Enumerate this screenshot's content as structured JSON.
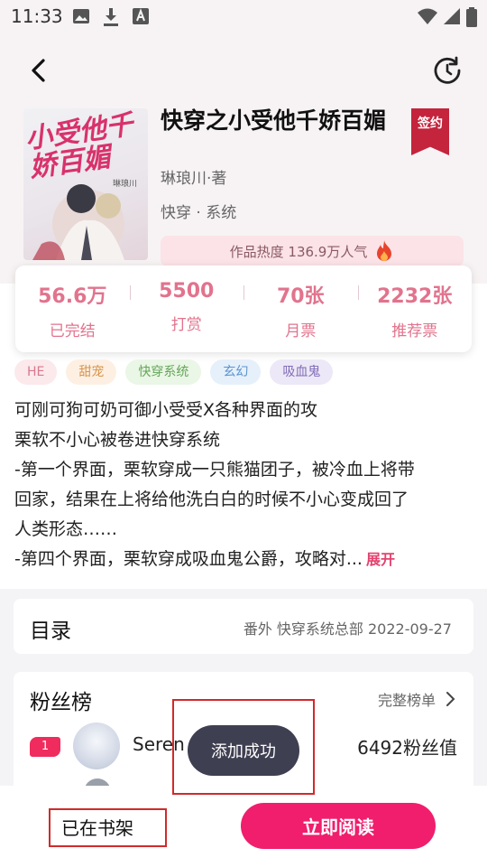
{
  "status_bar": {
    "time": "11:33",
    "left_icons": [
      "image-icon",
      "download-icon",
      "text-a-icon"
    ],
    "right_icons": [
      "wifi-icon",
      "signal-icon",
      "battery-icon"
    ]
  },
  "header": {
    "back_icon": "chevron-left-icon",
    "refresh_icon": "refresh-icon"
  },
  "book": {
    "cover_title": "小受他千娇百媚",
    "cover_author": "琳琅川",
    "title": "快穿之小受他千娇百媚",
    "author": "琳琅川·著",
    "genre": "快穿 · 系统",
    "signed_badge": "签约",
    "heat_text": "作品热度 136.9万人气",
    "heat_icon": "flame-icon"
  },
  "stats": [
    {
      "value": "56.6万",
      "label": "已完结"
    },
    {
      "value": "5500",
      "label": "打赏"
    },
    {
      "value": "70张",
      "label": "月票"
    },
    {
      "value": "2232张",
      "label": "推荐票"
    }
  ],
  "tags": [
    {
      "label": "HE",
      "bg": "#fbe9ec",
      "fg": "#d9788c"
    },
    {
      "label": "甜宠",
      "bg": "#fdf0e3",
      "fg": "#d8944d"
    },
    {
      "label": "快穿系统",
      "bg": "#eaf6e6",
      "fg": "#64a558"
    },
    {
      "label": "玄幻",
      "bg": "#e5f0fb",
      "fg": "#5b93cf"
    },
    {
      "label": "吸血鬼",
      "bg": "#ece8f7",
      "fg": "#7f6bb6"
    }
  ],
  "intro": {
    "lines": [
      "可刚可狗可奶可御小受受X各种界面的攻",
      "栗软不小心被卷进快穿系统",
      "-第一个界面，栗软穿成一只熊猫团子，被冷血上将带",
      "回家，结果在上将给他洗白白的时候不小心变成回了",
      "人类形态……",
      "-第四个界面，栗软穿成吸血鬼公爵，攻略对..."
    ],
    "expand": "展开"
  },
  "catalog": {
    "title": "目录",
    "meta": "番外  快穿系统总部  2022-09-27"
  },
  "fans": {
    "title": "粉丝榜",
    "full_list": "完整榜单",
    "entries": [
      {
        "rank": "1",
        "name": "Seren",
        "value": "6492粉丝值"
      }
    ]
  },
  "toast": "添加成功",
  "bottom": {
    "shelf": "已在书架",
    "read": "立即阅读"
  },
  "colors": {
    "accent": "#f01e6d",
    "stat_pink": "#e2738d",
    "signed_red": "#c4243c",
    "highlight_red": "#d12a2a",
    "toast_bg": "#3f3f52"
  }
}
